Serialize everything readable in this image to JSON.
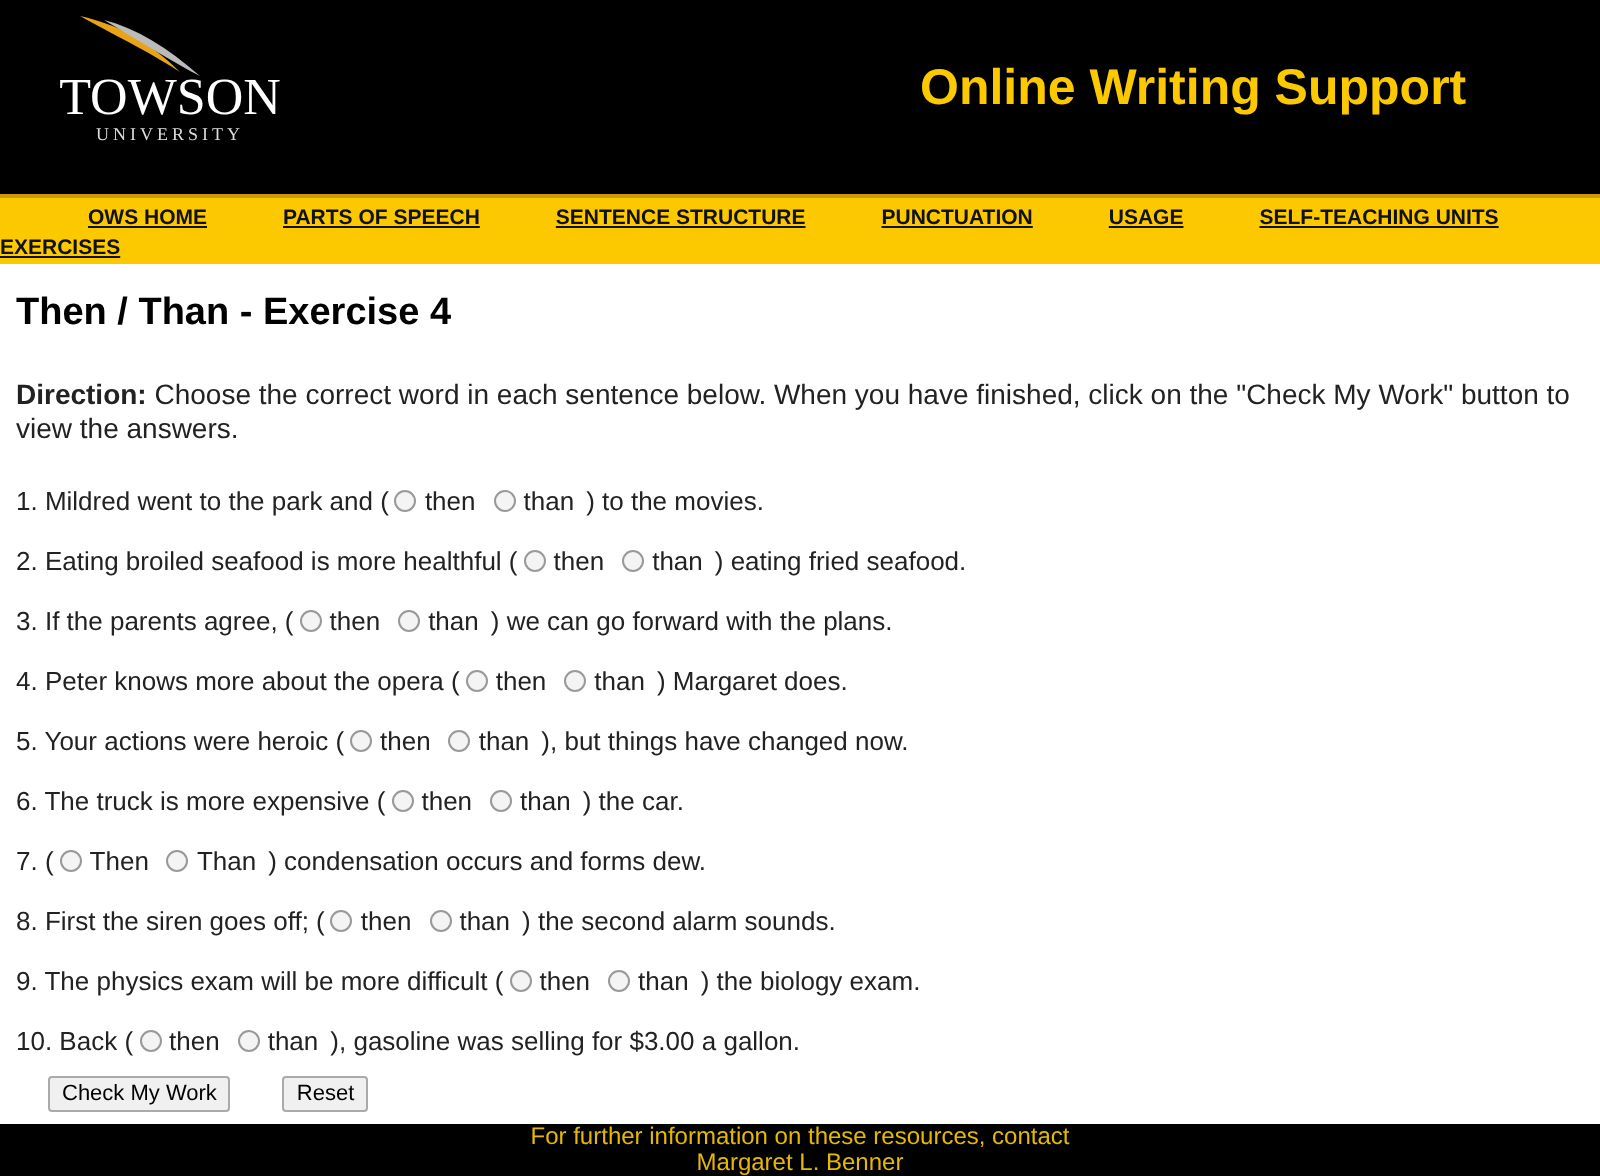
{
  "header": {
    "logo": {
      "name": "TOWSON",
      "subtitle": "UNIVERSITY"
    },
    "title": "Online Writing Support"
  },
  "nav": [
    "OWS HOME",
    "PARTS OF SPEECH",
    "SENTENCE STRUCTURE",
    "PUNCTUATION",
    "USAGE",
    "SELF-TEACHING UNITS",
    "EXERCISES"
  ],
  "page_title": "Then / Than - Exercise 4",
  "direction": "**Direction:** Choose the correct word in each sentence below. When you have finished, click on the \"Check My Work\" button to view the answers.",
  "questions": [
    {
      "before": "1. Mildred went to the park and (",
      "options": [
        {
          "label": "then",
          "selected": false
        },
        {
          "label": "than",
          "selected": false
        }
      ],
      "after": ") to the movies."
    },
    {
      "before": "2. Eating broiled seafood is more healthful (",
      "options": [
        {
          "label": "then",
          "selected": false
        },
        {
          "label": "than",
          "selected": false
        }
      ],
      "after": ") eating fried seafood."
    },
    {
      "before": "3. If the parents agree, (",
      "options": [
        {
          "label": "then",
          "selected": false
        },
        {
          "label": "than",
          "selected": false
        }
      ],
      "after": ") we can go forward with the plans."
    },
    {
      "before": "4. Peter knows more about the opera (",
      "options": [
        {
          "label": "then",
          "selected": false
        },
        {
          "label": "than",
          "selected": false
        }
      ],
      "after": ") Margaret does."
    },
    {
      "before": "5. Your actions were heroic (",
      "options": [
        {
          "label": "then",
          "selected": false
        },
        {
          "label": "than",
          "selected": false
        }
      ],
      "after": "), but things have changed now."
    },
    {
      "before": "6. The truck is more expensive (",
      "options": [
        {
          "label": "then",
          "selected": false
        },
        {
          "label": "than",
          "selected": false
        }
      ],
      "after": ") the car."
    },
    {
      "before": "7. (",
      "options": [
        {
          "label": "Then",
          "selected": false
        },
        {
          "label": "Than",
          "selected": false
        }
      ],
      "after": ") condensation occurs and forms dew."
    },
    {
      "before": "8. First the siren goes off; (",
      "options": [
        {
          "label": "then",
          "selected": false
        },
        {
          "label": "than",
          "selected": false
        }
      ],
      "after": ") the second alarm sounds."
    },
    {
      "before": "9. The physics exam will be more difficult (",
      "options": [
        {
          "label": "then",
          "selected": false
        },
        {
          "label": "than",
          "selected": false
        }
      ],
      "after": ") the biology exam."
    },
    {
      "before": "10. Back (",
      "options": [
        {
          "label": "then",
          "selected": false
        },
        {
          "label": "than",
          "selected": false
        }
      ],
      "after": "), gasoline was selling for $3.00 a gallon."
    }
  ],
  "buttons": [
    "Check My Work",
    "Reset"
  ],
  "footer": [
    "For further information on these resources, contact",
    "Margaret L. Benner"
  ]
}
